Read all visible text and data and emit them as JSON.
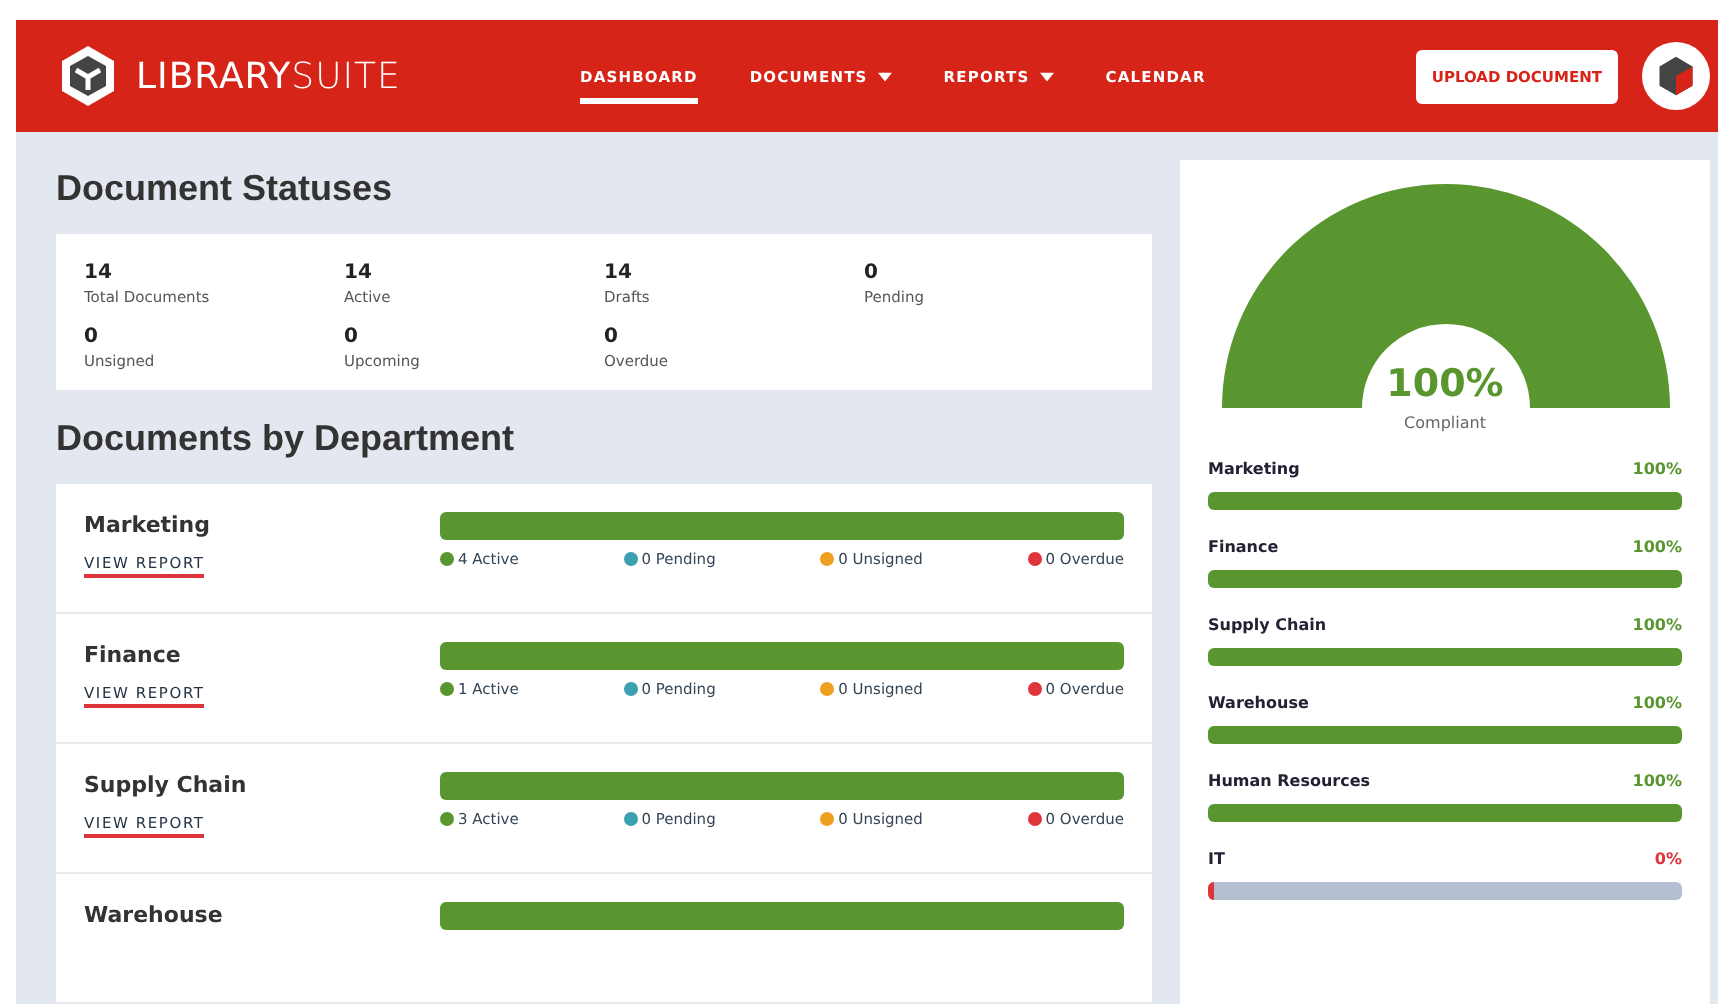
{
  "header": {
    "brand": {
      "bold": "LIBRARY",
      "light": "SUITE"
    },
    "nav": [
      {
        "label": "DASHBOARD",
        "selected": true,
        "dropdown": false
      },
      {
        "label": "DOCUMENTS",
        "selected": false,
        "dropdown": true
      },
      {
        "label": "REPORTS",
        "selected": false,
        "dropdown": true
      },
      {
        "label": "CALENDAR",
        "selected": false,
        "dropdown": false
      }
    ],
    "upload_button": "UPLOAD DOCUMENT"
  },
  "statuses": {
    "title": "Document Statuses",
    "items": [
      {
        "value": "14",
        "label": "Total Documents"
      },
      {
        "value": "14",
        "label": "Active"
      },
      {
        "value": "14",
        "label": "Drafts"
      },
      {
        "value": "0",
        "label": "Pending"
      },
      {
        "value": "0",
        "label": "Unsigned"
      },
      {
        "value": "0",
        "label": "Upcoming"
      },
      {
        "value": "0",
        "label": "Overdue"
      }
    ]
  },
  "departments": {
    "title": "Documents by Department",
    "rows": [
      {
        "name": "Marketing",
        "link": "VIEW REPORT",
        "level": 1,
        "legend": [
          {
            "text": "4 Active",
            "color": "#5a962f"
          },
          {
            "text": "0 Pending",
            "color": "#3ba0b0"
          },
          {
            "text": "0 Unsigned",
            "color": "#f0a020"
          },
          {
            "text": "0 Overdue",
            "color": "#e0343c"
          }
        ]
      },
      {
        "name": "Finance",
        "link": "VIEW REPORT",
        "level": 1,
        "legend": [
          {
            "text": "1 Active",
            "color": "#5a962f"
          },
          {
            "text": "0 Pending",
            "color": "#3ba0b0"
          },
          {
            "text": "0 Unsigned",
            "color": "#f0a020"
          },
          {
            "text": "0 Overdue",
            "color": "#e0343c"
          }
        ]
      },
      {
        "name": "Supply Chain",
        "link": "VIEW REPORT",
        "level": 1,
        "legend": [
          {
            "text": "3 Active",
            "color": "#5a962f"
          },
          {
            "text": "0 Pending",
            "color": "#3ba0b0"
          },
          {
            "text": "0 Unsigned",
            "color": "#f0a020"
          },
          {
            "text": "0 Overdue",
            "color": "#e0343c"
          }
        ]
      },
      {
        "name": "Warehouse",
        "level": 1
      }
    ]
  },
  "compliance": {
    "level": 1,
    "value": "100%",
    "label": "Compliant",
    "items": [
      {
        "name": "Marketing",
        "value": "100%",
        "level": 1
      },
      {
        "name": "Finance",
        "value": "100%",
        "level": 1
      },
      {
        "name": "Supply Chain",
        "value": "100%",
        "level": 1
      },
      {
        "name": "Warehouse",
        "value": "100%",
        "level": 1
      },
      {
        "name": "Human Resources",
        "value": "100%",
        "level": 1
      },
      {
        "name": "IT",
        "value": "0%",
        "level": 0
      }
    ]
  }
}
